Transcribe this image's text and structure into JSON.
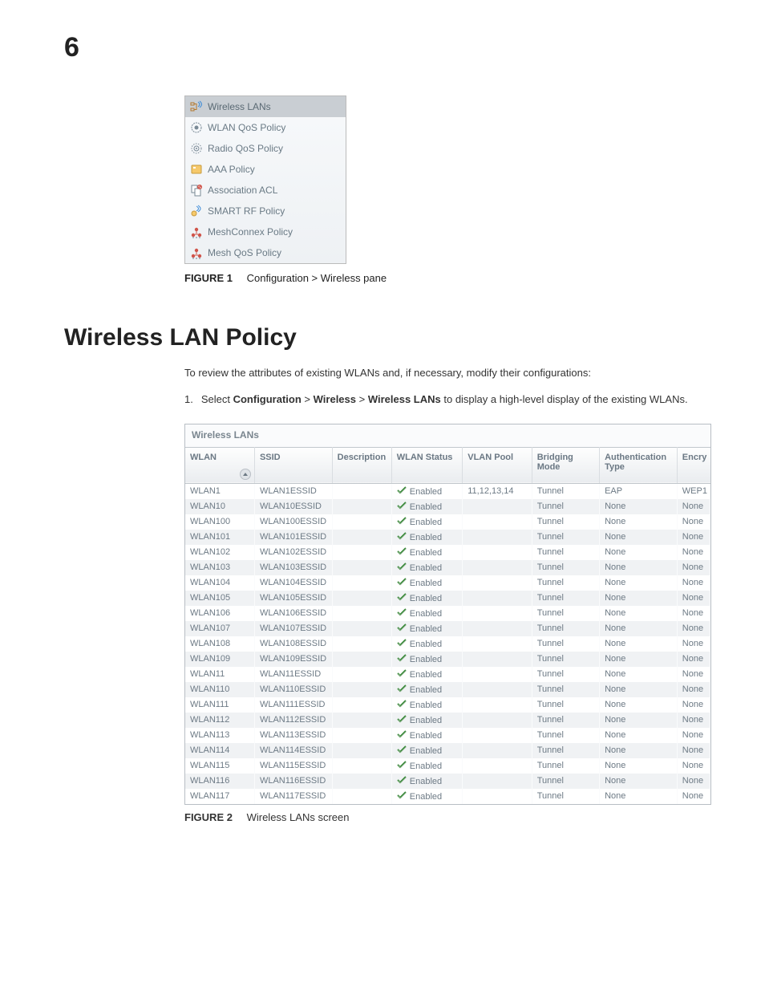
{
  "chapter_number": "6",
  "tree": {
    "items": [
      {
        "id": "wireless-lans",
        "label": "Wireless LANs",
        "selected": true
      },
      {
        "id": "wlan-qos-policy",
        "label": "WLAN QoS Policy",
        "selected": false
      },
      {
        "id": "radio-qos-policy",
        "label": "Radio QoS Policy",
        "selected": false
      },
      {
        "id": "aaa-policy",
        "label": "AAA Policy",
        "selected": false
      },
      {
        "id": "association-acl",
        "label": "Association ACL",
        "selected": false
      },
      {
        "id": "smart-rf-policy",
        "label": "SMART RF Policy",
        "selected": false
      },
      {
        "id": "meshconnex-policy",
        "label": "MeshConnex Policy",
        "selected": false
      },
      {
        "id": "mesh-qos-policy",
        "label": "Mesh QoS Policy",
        "selected": false
      }
    ]
  },
  "figure1": {
    "label": "FIGURE 1",
    "caption": "Configuration > Wireless pane"
  },
  "section_heading": "Wireless LAN Policy",
  "intro_text": "To review the attributes of existing WLANs and, if necessary, modify their configurations:",
  "step1": {
    "num": "1.",
    "pre": "Select ",
    "b1": "Configuration",
    "sep1": " > ",
    "b2": "Wireless",
    "sep2": " > ",
    "b3": "Wireless LANs",
    "post": " to display a high-level display of the existing WLANs."
  },
  "wlan_panel": {
    "title": "Wireless LANs",
    "headers": {
      "wlan": "WLAN",
      "ssid": "SSID",
      "description": "Description",
      "status": "WLAN Status",
      "pool": "VLAN Pool",
      "bridge": "Bridging Mode",
      "auth": "Authentication Type",
      "enc": "Encry"
    },
    "rows": [
      {
        "wlan": "WLAN1",
        "ssid": "WLAN1ESSID",
        "desc": "",
        "status": "Enabled",
        "pool": "11,12,13,14",
        "bridge": "Tunnel",
        "auth": "EAP",
        "enc": "WEP1"
      },
      {
        "wlan": "WLAN10",
        "ssid": "WLAN10ESSID",
        "desc": "",
        "status": "Enabled",
        "pool": "",
        "bridge": "Tunnel",
        "auth": "None",
        "enc": "None"
      },
      {
        "wlan": "WLAN100",
        "ssid": "WLAN100ESSID",
        "desc": "",
        "status": "Enabled",
        "pool": "",
        "bridge": "Tunnel",
        "auth": "None",
        "enc": "None"
      },
      {
        "wlan": "WLAN101",
        "ssid": "WLAN101ESSID",
        "desc": "",
        "status": "Enabled",
        "pool": "",
        "bridge": "Tunnel",
        "auth": "None",
        "enc": "None"
      },
      {
        "wlan": "WLAN102",
        "ssid": "WLAN102ESSID",
        "desc": "",
        "status": "Enabled",
        "pool": "",
        "bridge": "Tunnel",
        "auth": "None",
        "enc": "None"
      },
      {
        "wlan": "WLAN103",
        "ssid": "WLAN103ESSID",
        "desc": "",
        "status": "Enabled",
        "pool": "",
        "bridge": "Tunnel",
        "auth": "None",
        "enc": "None"
      },
      {
        "wlan": "WLAN104",
        "ssid": "WLAN104ESSID",
        "desc": "",
        "status": "Enabled",
        "pool": "",
        "bridge": "Tunnel",
        "auth": "None",
        "enc": "None"
      },
      {
        "wlan": "WLAN105",
        "ssid": "WLAN105ESSID",
        "desc": "",
        "status": "Enabled",
        "pool": "",
        "bridge": "Tunnel",
        "auth": "None",
        "enc": "None"
      },
      {
        "wlan": "WLAN106",
        "ssid": "WLAN106ESSID",
        "desc": "",
        "status": "Enabled",
        "pool": "",
        "bridge": "Tunnel",
        "auth": "None",
        "enc": "None"
      },
      {
        "wlan": "WLAN107",
        "ssid": "WLAN107ESSID",
        "desc": "",
        "status": "Enabled",
        "pool": "",
        "bridge": "Tunnel",
        "auth": "None",
        "enc": "None"
      },
      {
        "wlan": "WLAN108",
        "ssid": "WLAN108ESSID",
        "desc": "",
        "status": "Enabled",
        "pool": "",
        "bridge": "Tunnel",
        "auth": "None",
        "enc": "None"
      },
      {
        "wlan": "WLAN109",
        "ssid": "WLAN109ESSID",
        "desc": "",
        "status": "Enabled",
        "pool": "",
        "bridge": "Tunnel",
        "auth": "None",
        "enc": "None"
      },
      {
        "wlan": "WLAN11",
        "ssid": "WLAN11ESSID",
        "desc": "",
        "status": "Enabled",
        "pool": "",
        "bridge": "Tunnel",
        "auth": "None",
        "enc": "None"
      },
      {
        "wlan": "WLAN110",
        "ssid": "WLAN110ESSID",
        "desc": "",
        "status": "Enabled",
        "pool": "",
        "bridge": "Tunnel",
        "auth": "None",
        "enc": "None"
      },
      {
        "wlan": "WLAN111",
        "ssid": "WLAN111ESSID",
        "desc": "",
        "status": "Enabled",
        "pool": "",
        "bridge": "Tunnel",
        "auth": "None",
        "enc": "None"
      },
      {
        "wlan": "WLAN112",
        "ssid": "WLAN112ESSID",
        "desc": "",
        "status": "Enabled",
        "pool": "",
        "bridge": "Tunnel",
        "auth": "None",
        "enc": "None"
      },
      {
        "wlan": "WLAN113",
        "ssid": "WLAN113ESSID",
        "desc": "",
        "status": "Enabled",
        "pool": "",
        "bridge": "Tunnel",
        "auth": "None",
        "enc": "None"
      },
      {
        "wlan": "WLAN114",
        "ssid": "WLAN114ESSID",
        "desc": "",
        "status": "Enabled",
        "pool": "",
        "bridge": "Tunnel",
        "auth": "None",
        "enc": "None"
      },
      {
        "wlan": "WLAN115",
        "ssid": "WLAN115ESSID",
        "desc": "",
        "status": "Enabled",
        "pool": "",
        "bridge": "Tunnel",
        "auth": "None",
        "enc": "None"
      },
      {
        "wlan": "WLAN116",
        "ssid": "WLAN116ESSID",
        "desc": "",
        "status": "Enabled",
        "pool": "",
        "bridge": "Tunnel",
        "auth": "None",
        "enc": "None"
      },
      {
        "wlan": "WLAN117",
        "ssid": "WLAN117ESSID",
        "desc": "",
        "status": "Enabled",
        "pool": "",
        "bridge": "Tunnel",
        "auth": "None",
        "enc": "None"
      }
    ]
  },
  "figure2": {
    "label": "FIGURE 2",
    "caption": "Wireless LANs screen"
  }
}
